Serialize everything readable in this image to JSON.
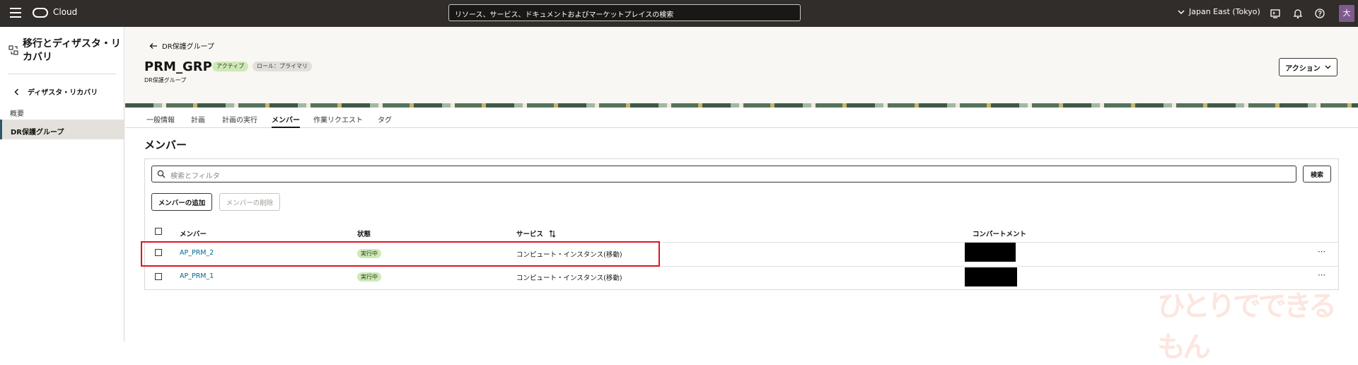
{
  "topbar": {
    "brand": "Cloud",
    "search_placeholder": "リソース、サービス、ドキュメントおよびマーケットプレイスの検索",
    "region": "Japan East (Tokyo)",
    "avatar": "大"
  },
  "sidebar": {
    "title": "移行とディザスタ・リカバリ",
    "back_label": "ディザスタ・リカバリ",
    "overview": "概要",
    "active_item": "DR保護グループ"
  },
  "header": {
    "breadcrumb": "DR保護グループ",
    "title": "PRM_GRP",
    "badge_status": "アクティブ",
    "badge_role": "ロール：プライマリ",
    "subtitle": "DR保護グループ",
    "actions_label": "アクション"
  },
  "tabs": [
    {
      "label": "一般情報"
    },
    {
      "label": "計画"
    },
    {
      "label": "計画の実行"
    },
    {
      "label": "メンバー"
    },
    {
      "label": "作業リクエスト"
    },
    {
      "label": "タグ"
    }
  ],
  "members": {
    "section_title": "メンバー",
    "search_placeholder": "検索とフィルタ",
    "search_button": "検索",
    "add_button": "メンバーの追加",
    "delete_button": "メンバーの削除",
    "columns": [
      "メンバー",
      "状態",
      "サービス",
      "コンパートメント"
    ],
    "rows": [
      {
        "name": "AP_PRM_2",
        "state": "実行中",
        "service": "コンピュート・インスタンス(移動)"
      },
      {
        "name": "AP_PRM_1",
        "state": "実行中",
        "service": "コンピュート・インスタンス(移動)"
      }
    ]
  },
  "watermark": "ひとりでできるもん"
}
